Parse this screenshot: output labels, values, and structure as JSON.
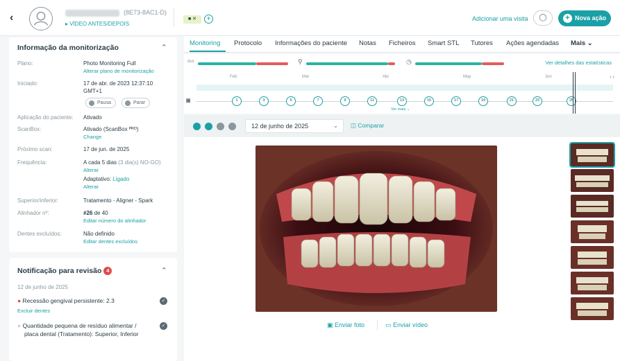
{
  "header": {
    "patient_id": "(8E73-8AC1-D)",
    "patient_link": "▸ VÍDEO ANTES/DEPOIS",
    "add_visit": "Adicionar uma visita",
    "new_action": "Nova ação"
  },
  "monitoring_card": {
    "title": "Informação da monitorização",
    "rows": [
      {
        "label": "Plano:",
        "value": "Photo Monitoring Full",
        "link": "Alterar plano de monitorização"
      },
      {
        "label": "Iniciado:",
        "value": "17 de abr. de 2023 12:37:10",
        "value2": "GMT+1"
      },
      {
        "label": "Aplicação do paciente:",
        "value": "Ativado"
      },
      {
        "label": "ScanBox:",
        "value": "Ativado (ScanBox ᴾᴿᴼ)",
        "link": "Change"
      },
      {
        "label": "Próximo scan:",
        "value": "17 de jun. de 2025"
      },
      {
        "label": "Frequência:",
        "value": "A cada 5 dias",
        "value_note": " (3 dia(s) NO-GO)",
        "link": "Alterar",
        "extra": "Adaptativo: ",
        "extra_state": "Ligado",
        "link2": "Alterar"
      },
      {
        "label": "Superior/inferior:",
        "value": "Tratamento - Aligner - Spark"
      },
      {
        "label": "Alinhador nº:",
        "value_bold": "#26",
        "value": " de 40",
        "link": "Editar número do alinhador"
      },
      {
        "label": "Dentes excluídos:",
        "value": "Não definido",
        "link": "Editar dentes excluídos"
      }
    ],
    "pause_label": "Pausa",
    "stop_label": "Parar"
  },
  "notification_card": {
    "title": "Notificação para revisão",
    "badge": "4",
    "date": "12 de junho de 2025",
    "items": [
      {
        "text": "Recessão gengival persistente: 2.3",
        "link": "Excluir dentes"
      },
      {
        "text": "Quantidade pequena de resíduo alimentar /",
        "text2": "placa dental (Tratamento): Superior, Inferior"
      }
    ]
  },
  "tabs": [
    "Monitoring",
    "Protocolo",
    "Informações do paciente",
    "Notas",
    "Ficheiros",
    "Smart STL",
    "Tutores",
    "Ações agendadas",
    "Mais ⌄"
  ],
  "stats": {
    "label": "dus",
    "link": "Ver detalhes das estatísticas"
  },
  "timeline": {
    "months": [
      "Feb",
      "Mar",
      "Abr",
      "May",
      "Jun"
    ],
    "scans": [
      "1",
      "3",
      "5",
      "7",
      "9",
      "11",
      "13",
      "15",
      "17",
      "19",
      "21",
      "23",
      "25"
    ],
    "more": "Ver mais ⌄"
  },
  "viewer": {
    "date": "12 de junho de 2025",
    "compare": "Comparar",
    "send_photo": "Enviar foto",
    "send_video": "Enviar vídeo"
  },
  "colors": {
    "accent": "#1aa0a6",
    "alert": "#e24a4a",
    "stat_good": "#2bb3a3",
    "stat_bad": "#e25c5c"
  }
}
